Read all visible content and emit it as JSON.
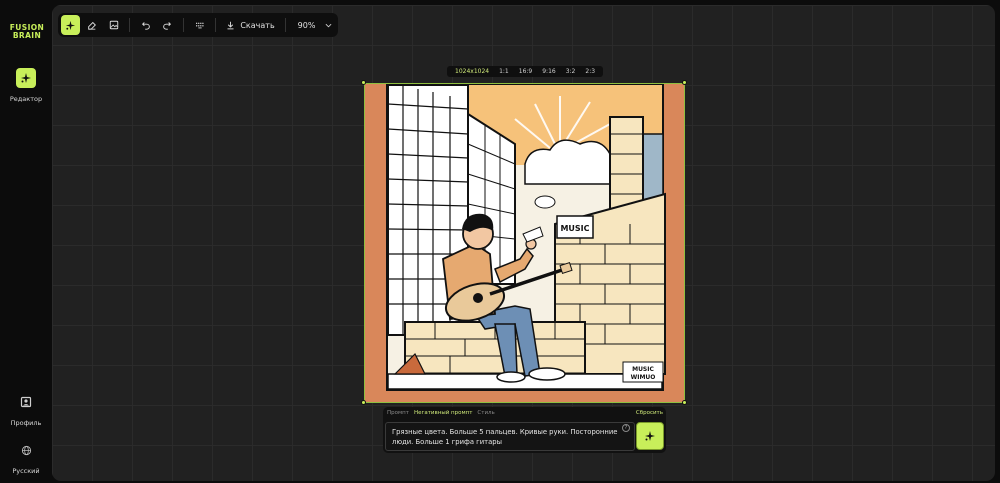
{
  "app": {
    "logo_line1": "FUSION",
    "logo_line2": "BRAIN"
  },
  "sidebar": {
    "items": [
      {
        "label": "Редактор",
        "icon": "sparkle-icon",
        "active": true
      },
      {
        "label": "Профиль",
        "icon": "profile-icon",
        "active": false
      },
      {
        "label": "Русский",
        "icon": "globe-icon",
        "active": false
      }
    ]
  },
  "toolbar": {
    "tools": [
      "sparkle-tool-icon",
      "eraser-icon",
      "image-icon"
    ],
    "undo_icon": "undo-icon",
    "redo_icon": "redo-icon",
    "grid_icon": "grid-dots-icon",
    "download_label": "Скачать",
    "zoom_label": "90%"
  },
  "ratios": [
    "1024x1024",
    "1:1",
    "16:9",
    "9:16",
    "3:2",
    "2:3"
  ],
  "image": {
    "sign_text": "MUSIC",
    "corner_text_line1": "MUSIC",
    "corner_text_line2": "WIMUO"
  },
  "prompt": {
    "tabs": [
      "Промпт",
      "Негативный промпт",
      "Стиль"
    ],
    "active_tab": "Негативный промпт",
    "reset_label": "Сбросить",
    "text": "Грязные цвета. Больше 5 пальцев. Кривые руки. Посторонние люди. Больше 1 грифа  гитары",
    "help_label": "?"
  },
  "colors": {
    "accent": "#c8ef5a",
    "canvas": "#212121",
    "sidebar": "#0c0c0c",
    "image_border": "#d9875a"
  }
}
